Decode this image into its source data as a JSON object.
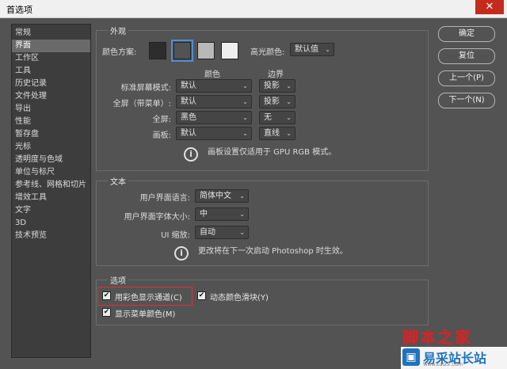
{
  "window": {
    "title": "首选项",
    "close_glyph": "✕"
  },
  "sidebar": {
    "items": [
      {
        "label": "常规"
      },
      {
        "label": "界面",
        "selected": true
      },
      {
        "label": "工作区"
      },
      {
        "label": "工具"
      },
      {
        "label": "历史记录"
      },
      {
        "label": "文件处理"
      },
      {
        "label": "导出"
      },
      {
        "label": "性能"
      },
      {
        "label": "暂存盘"
      },
      {
        "label": "光标"
      },
      {
        "label": "透明度与色域"
      },
      {
        "label": "单位与标尺"
      },
      {
        "label": "参考线、网格和切片"
      },
      {
        "label": "增效工具"
      },
      {
        "label": "文字"
      },
      {
        "label": "3D"
      },
      {
        "label": "技术预览"
      }
    ]
  },
  "appearance": {
    "title": "外观",
    "color_theme_label": "颜色方案:",
    "swatches": [
      "#2d2d2d",
      "#535353",
      "#b8b8b8",
      "#efefef"
    ],
    "selected_swatch": 1,
    "highlight_label": "高光颜色:",
    "highlight_value": "默认值",
    "col_color": "颜色",
    "col_border": "边界",
    "rows": [
      {
        "label": "标准屏幕模式:",
        "color": "默认",
        "border": "投影"
      },
      {
        "label": "全屏（带菜单）:",
        "color": "默认",
        "border": "投影"
      },
      {
        "label": "全屏:",
        "color": "黑色",
        "border": "无"
      },
      {
        "label": "画板:",
        "color": "默认",
        "border": "直线"
      }
    ],
    "info": "画板设置仅适用于 GPU RGB 模式。"
  },
  "text": {
    "title": "文本",
    "ui_language_label": "用户界面语言:",
    "ui_language_value": "简体中文",
    "ui_font_size_label": "用户界面字体大小:",
    "ui_font_size_value": "中",
    "ui_scale_label": "UI 缩放:",
    "ui_scale_value": "自动",
    "info": "更改将在下一次启动 Photoshop 时生效。"
  },
  "options": {
    "title": "选项",
    "checkboxes": [
      {
        "label": "用彩色显示通道(C)",
        "checked": true
      },
      {
        "label": "动态颜色滑块(Y)",
        "checked": true
      },
      {
        "label": "显示菜单颜色(M)",
        "checked": true
      }
    ],
    "check_glyph": "✔"
  },
  "buttons": {
    "ok": "确定",
    "reset": "复位",
    "prev": "上一个(P)",
    "next": "下一个(N)"
  },
  "icons": {
    "info": "i",
    "dropdown": "⌄"
  },
  "watermark": {
    "line1": "脚本之家",
    "line2": "易采站长站",
    "line2_sub": "Www.Easck.Com"
  }
}
